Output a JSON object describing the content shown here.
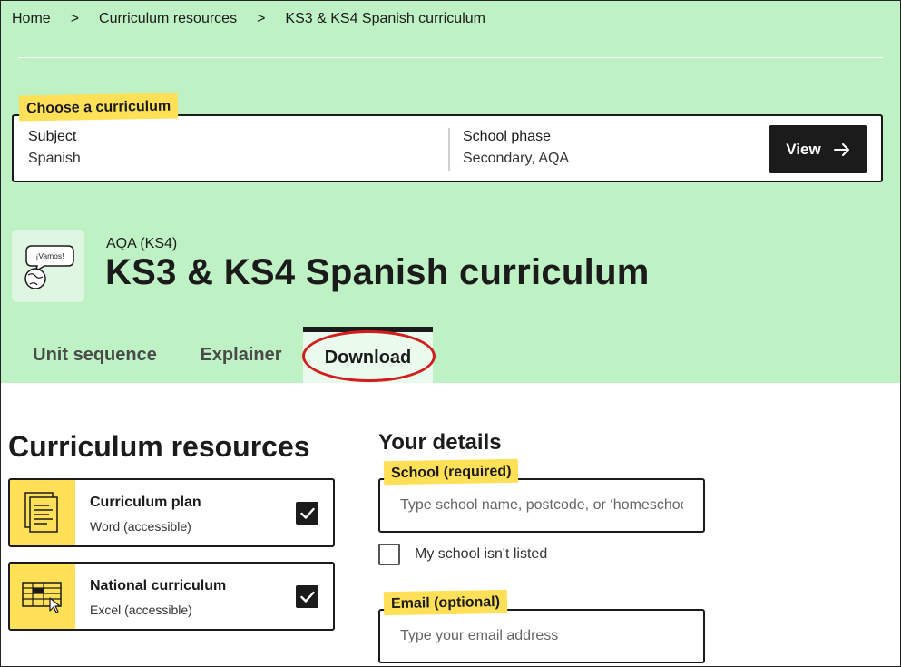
{
  "breadcrumb": {
    "items": [
      "Home",
      "Curriculum resources",
      "KS3 & KS4 Spanish curriculum"
    ],
    "separator": ">"
  },
  "chooser": {
    "heading": "Choose a curriculum",
    "subject_label": "Subject",
    "subject_value": "Spanish",
    "phase_label": "School phase",
    "phase_value": "Secondary, AQA",
    "view_label": "View",
    "view_icon": "arrow-right-icon"
  },
  "header": {
    "icon": "speech-bubble-globe-icon",
    "icon_text": "¡Vamos!",
    "overline": "AQA (KS4)",
    "title": "KS3 & KS4 Spanish curriculum"
  },
  "tabs": [
    {
      "label": "Unit sequence",
      "active": false
    },
    {
      "label": "Explainer",
      "active": false
    },
    {
      "label": "Download",
      "active": true
    }
  ],
  "resources": {
    "heading": "Curriculum resources",
    "items": [
      {
        "title": "Curriculum plan",
        "subtitle": "Word (accessible)",
        "checked": true,
        "icon": "document-stack-icon"
      },
      {
        "title": "National curriculum",
        "subtitle": "Excel (accessible)",
        "checked": true,
        "icon": "spreadsheet-cursor-icon"
      }
    ]
  },
  "details": {
    "heading": "Your details",
    "school_label": "School (required)",
    "school_placeholder": "Type school name, postcode, or ‘homeschool’",
    "not_listed_label": "My school isn't listed",
    "email_label": "Email (optional)",
    "email_placeholder": "Type your email address"
  },
  "colors": {
    "hero_bg": "#bef2c4",
    "highlight": "#ffe056",
    "dark": "#1b1b1b",
    "annotation": "#d31d1d"
  }
}
